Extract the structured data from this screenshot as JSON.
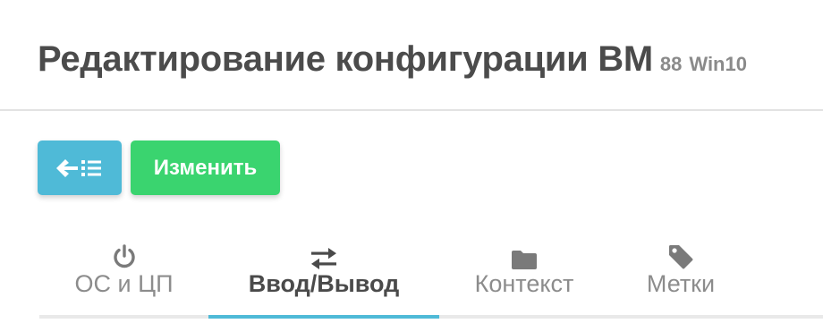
{
  "header": {
    "title": "Редактирование конфигурации ВМ",
    "vm_id": "88",
    "vm_name": "Win10"
  },
  "toolbar": {
    "back_icon": "arrow-left-list-icon",
    "edit_label": "Изменить"
  },
  "tabs": [
    {
      "label": "ОС и ЦП",
      "icon": "power-icon",
      "active": false
    },
    {
      "label": "Ввод/Вывод",
      "icon": "exchange-arrows-icon",
      "active": true
    },
    {
      "label": "Контекст",
      "icon": "folder-icon",
      "active": false
    },
    {
      "label": "Метки",
      "icon": "tag-icon",
      "active": false
    }
  ],
  "colors": {
    "accent": "#4fbad7",
    "success": "#3ad46f",
    "title_text": "#4b4b4b",
    "muted_text": "#8c8c8c",
    "icon_gray": "#7a7a7a"
  }
}
